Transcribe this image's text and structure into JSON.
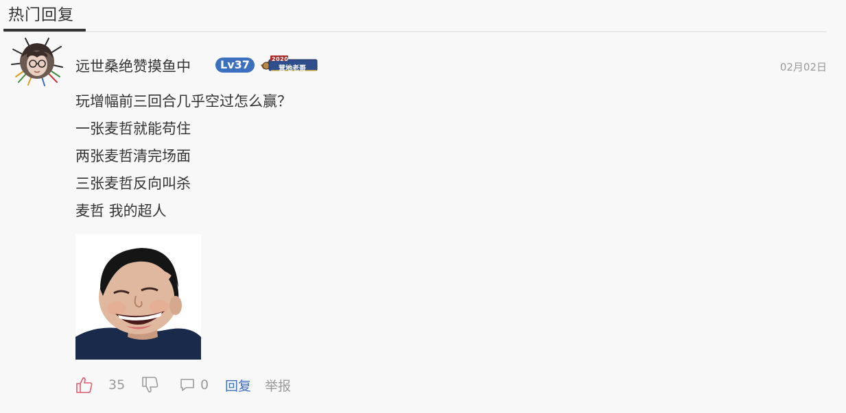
{
  "section": {
    "title": "热门回复"
  },
  "comment": {
    "username": "远世桑绝赞摸鱼中",
    "level": "Lv37",
    "medal": {
      "year": "2020",
      "text": "营地老哥"
    },
    "timestamp": "02月02日",
    "lines": [
      "玩增幅前三回合几乎空过怎么赢？",
      "一张麦哲就能苟住",
      "两张麦哲清完场面",
      "三张麦哲反向叫杀",
      "麦哲 我的超人"
    ],
    "actions": {
      "like_count": "35",
      "comment_count": "0",
      "reply_label": "回复",
      "report_label": "举报"
    }
  },
  "colors": {
    "accent_blue": "#3b6fbf",
    "like_pink": "#e05a6b",
    "muted_gray": "#999999"
  },
  "icons": [
    "thumbs-up-icon",
    "thumbs-down-icon",
    "comment-bubble-icon"
  ]
}
